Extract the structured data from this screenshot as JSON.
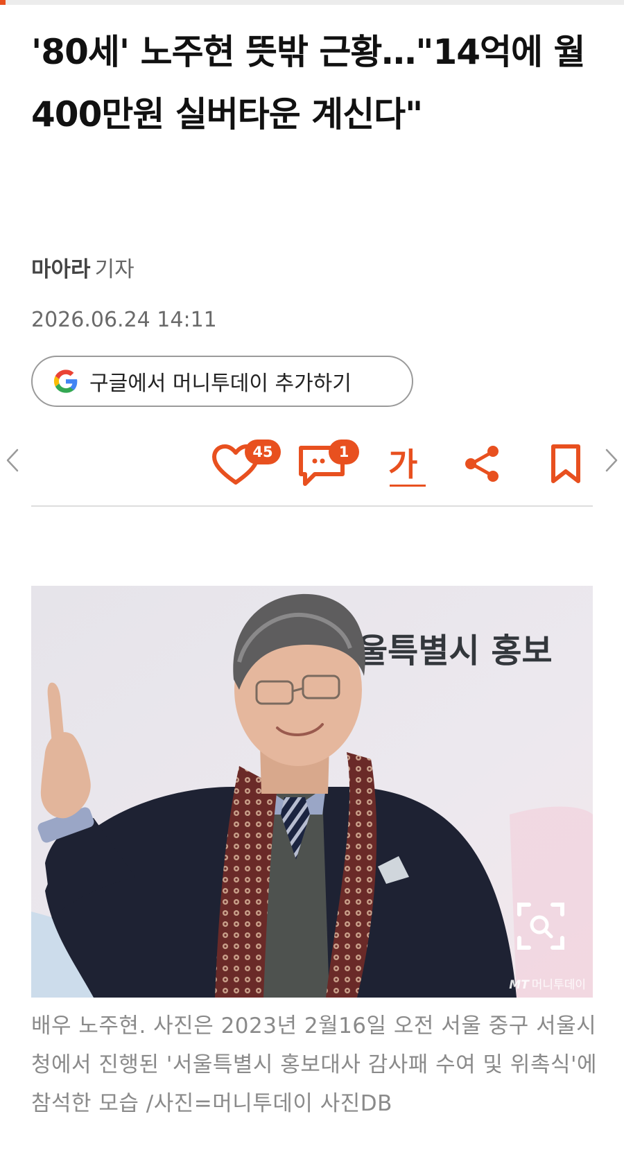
{
  "article": {
    "headline": "'80세' 노주현 뜻밖 근황…\"14억에 월 400만원 실버타운 계신다\"",
    "reporter_name": "마아라",
    "reporter_role": "기자",
    "date": "2026.06.24 14:11",
    "google_button_label": "구글에서 머니투데이 추가하기",
    "caption": "배우 노주현. 사진은 2023년 2월16일 오전 서울 중구 서울시청에서 진행된 '서울특별시 홍보대사 감사패 수여 및 위촉식'에 참석한 모습 /사진=머니투데이 사진DB"
  },
  "actions": {
    "like_count": "45",
    "comment_count": "1",
    "font_size_label": "가",
    "share_icon": "share-icon",
    "bookmark_icon": "bookmark-icon"
  },
  "photo": {
    "backdrop_text": "울특별시 홍보",
    "watermark_logo": "MT",
    "watermark_text": "머니투데이"
  },
  "colors": {
    "accent": "#e8501f",
    "text": "#111111",
    "caption": "#8a8a8a"
  }
}
